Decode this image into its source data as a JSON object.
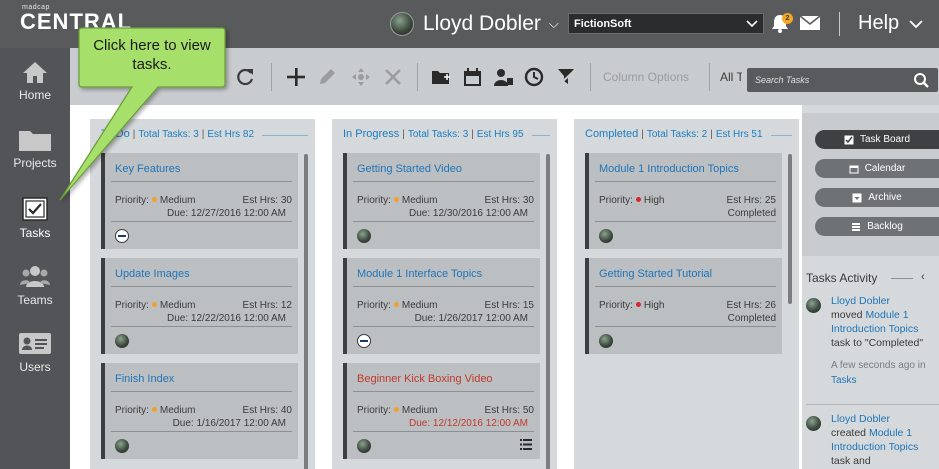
{
  "header": {
    "logo_small": "madcap",
    "logo_big": "CENTRAL",
    "user_name": "Lloyd Dobler",
    "company": "FictionSoft",
    "notification_count": "2",
    "help_label": "Help"
  },
  "leftnav": {
    "items": [
      {
        "label": "Home",
        "icon": "home-icon"
      },
      {
        "label": "Projects",
        "icon": "folder-icon"
      },
      {
        "label": "Tasks",
        "icon": "checkbox-icon"
      },
      {
        "label": "Teams",
        "icon": "team-icon"
      },
      {
        "label": "Users",
        "icon": "id-card-icon"
      }
    ],
    "active": "Tasks"
  },
  "toolbar": {
    "column_options_label": "Column Options",
    "all_tasks_label": "All Tasks",
    "search_placeholder": "Search Tasks"
  },
  "callout": {
    "text": "Click here to view tasks."
  },
  "columns": [
    {
      "name": "To Do",
      "total_label": "Total Tasks: 3",
      "est_label": "Est Hrs 82",
      "cards": [
        {
          "title": "Key Features",
          "priority": "Medium",
          "est": "Est Hrs: 30",
          "due": "Due: 12/27/2016 12:00 AM",
          "status": "",
          "assignee": "blocked",
          "title_color": "blue"
        },
        {
          "title": "Update Images",
          "priority": "Medium",
          "est": "Est Hrs: 12",
          "due": "Due: 12/22/2016 12:00 AM",
          "status": "",
          "assignee": "avatar",
          "title_color": "blue"
        },
        {
          "title": "Finish Index",
          "priority": "Medium",
          "est": "Est Hrs: 40",
          "due": "Due: 1/16/2017 12:00 AM",
          "status": "",
          "assignee": "avatar",
          "title_color": "blue"
        }
      ]
    },
    {
      "name": "In Progress",
      "total_label": "Total Tasks: 3",
      "est_label": "Est Hrs 95",
      "cards": [
        {
          "title": "Getting Started Video",
          "priority": "Medium",
          "est": "Est Hrs: 30",
          "due": "Due: 12/30/2016 12:00 AM",
          "status": "",
          "assignee": "avatar",
          "title_color": "blue"
        },
        {
          "title": "Module 1 Interface Topics",
          "priority": "Medium",
          "est": "Est Hrs: 15",
          "due": "Due: 1/26/2017 12:00 AM",
          "status": "",
          "assignee": "blocked",
          "title_color": "blue"
        },
        {
          "title": "Beginner Kick Boxing Video",
          "priority": "Medium",
          "est": "Est Hrs: 50",
          "due": "Due: 12/12/2016 12:00 AM",
          "status": "",
          "assignee": "avatar",
          "title_color": "red"
        }
      ]
    },
    {
      "name": "Completed",
      "total_label": "Total Tasks: 2",
      "est_label": "Est Hrs 51",
      "cards": [
        {
          "title": "Module 1 Introduction Topics",
          "priority": "High",
          "est": "Est Hrs: 25",
          "due": "",
          "status": "Completed",
          "assignee": "avatar",
          "title_color": "blue"
        },
        {
          "title": "Getting Started Tutorial",
          "priority": "High",
          "est": "Est Hrs: 26",
          "due": "",
          "status": "Completed",
          "assignee": "avatar",
          "title_color": "blue"
        }
      ]
    }
  ],
  "card_priority_label": "Priority:",
  "rightpanel": {
    "buttons": [
      {
        "label": "Task Board",
        "icon": "checkbox-icon",
        "active": true
      },
      {
        "label": "Calendar",
        "icon": "calendar-icon",
        "active": false
      },
      {
        "label": "Archive",
        "icon": "archive-icon",
        "active": false
      },
      {
        "label": "Backlog",
        "icon": "stack-icon",
        "active": false
      }
    ],
    "activity_title": "Tasks Activity",
    "activity": [
      {
        "user": "Lloyd Dobler",
        "verb": "moved",
        "target": "Module 1 Introduction Topics",
        "rest": "task to \"Completed\"",
        "time": "A few seconds ago in",
        "place": "Tasks"
      },
      {
        "user": "Lloyd Dobler",
        "verb": "created",
        "target": "Module 1 Introduction Topics",
        "rest": "task and",
        "time": "",
        "place": ""
      }
    ]
  },
  "colors": {
    "topbar": "#585a5c",
    "leftnav": "#525457",
    "toolbar": "#c9ccce",
    "column_bg": "#d6d9db",
    "card_bg": "#bcbfc2",
    "link_blue": "#1f74b8",
    "overdue_red": "#c0392b",
    "priority_medium": "#f0a030",
    "priority_high": "#d9262a",
    "callout_fill": "#a6e06a"
  }
}
